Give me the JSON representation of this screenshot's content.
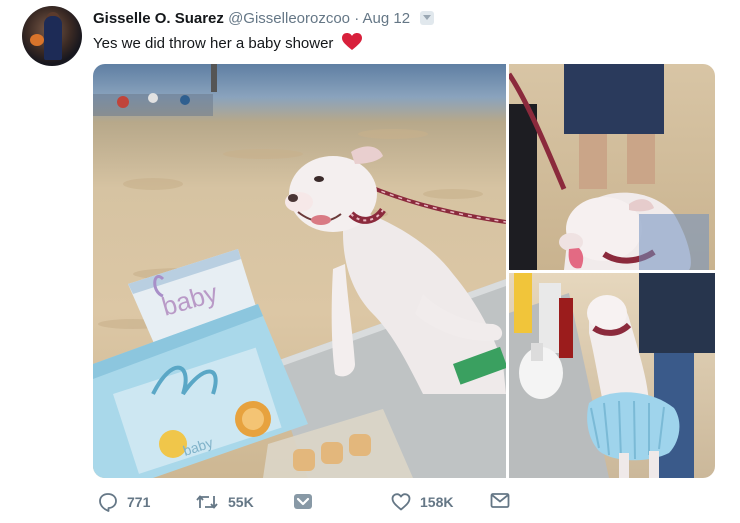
{
  "tweet": {
    "display_name": "Gisselle O. Suarez",
    "handle": "@Gisselleorozcoo",
    "separator": "·",
    "date": "Aug 12",
    "text": "Yes we did throw her a baby shower"
  },
  "media": {
    "gift_bag_text": "baby",
    "bottle_label": "baby"
  },
  "actions": {
    "reply_count": "771",
    "retweet_count": "55K",
    "like_count": "158K"
  },
  "colors": {
    "heart": "#d8203b",
    "leash": "#8b2a3c",
    "action_gray": "#657786"
  }
}
